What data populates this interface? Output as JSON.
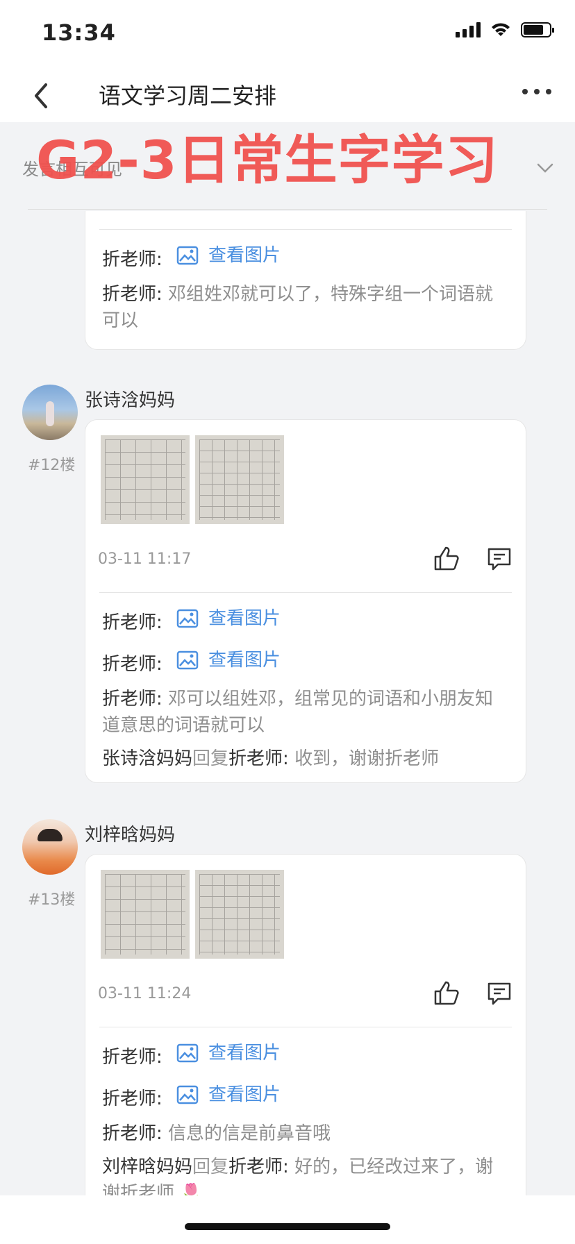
{
  "status_bar": {
    "time": "13:34"
  },
  "nav": {
    "title": "语文学习周二安排"
  },
  "visibility": {
    "text": "发言相互可见"
  },
  "overlay_title": "G2-3日常生字学习",
  "view_image_label": "查看图片",
  "prev_floor": {
    "replies": [
      {
        "name": "折老师:",
        "type": "image"
      },
      {
        "name": "折老师:",
        "type": "text",
        "msg": "邓组姓邓就可以了，特殊字组一个词语就可以"
      }
    ]
  },
  "floors": [
    {
      "user": "张诗浛妈妈",
      "floor": "#12楼",
      "time": "03-11 11:17",
      "replies": [
        {
          "name": "折老师:",
          "type": "image"
        },
        {
          "name": "折老师:",
          "type": "image"
        },
        {
          "name": "折老师:",
          "type": "text",
          "msg": "邓可以组姓邓，组常见的词语和小朋友知道意思的词语就可以"
        },
        {
          "name": "张诗浛妈妈",
          "reply_word": "回复",
          "target": "折老师:",
          "type": "reply",
          "msg": "收到，谢谢折老师"
        }
      ]
    },
    {
      "user": "刘梓晗妈妈",
      "floor": "#13楼",
      "time": "03-11 11:24",
      "replies": [
        {
          "name": "折老师:",
          "type": "image"
        },
        {
          "name": "折老师:",
          "type": "image"
        },
        {
          "name": "折老师:",
          "type": "text",
          "msg": "信息的信是前鼻音哦"
        },
        {
          "name": "刘梓晗妈妈",
          "reply_word": "回复",
          "target": "折老师:",
          "type": "reply",
          "msg": "好的，已经改过来了，谢谢折老师 🌷"
        }
      ]
    }
  ],
  "colors": {
    "accent_link": "#4a8fe0",
    "overlay": "#f0524f"
  }
}
